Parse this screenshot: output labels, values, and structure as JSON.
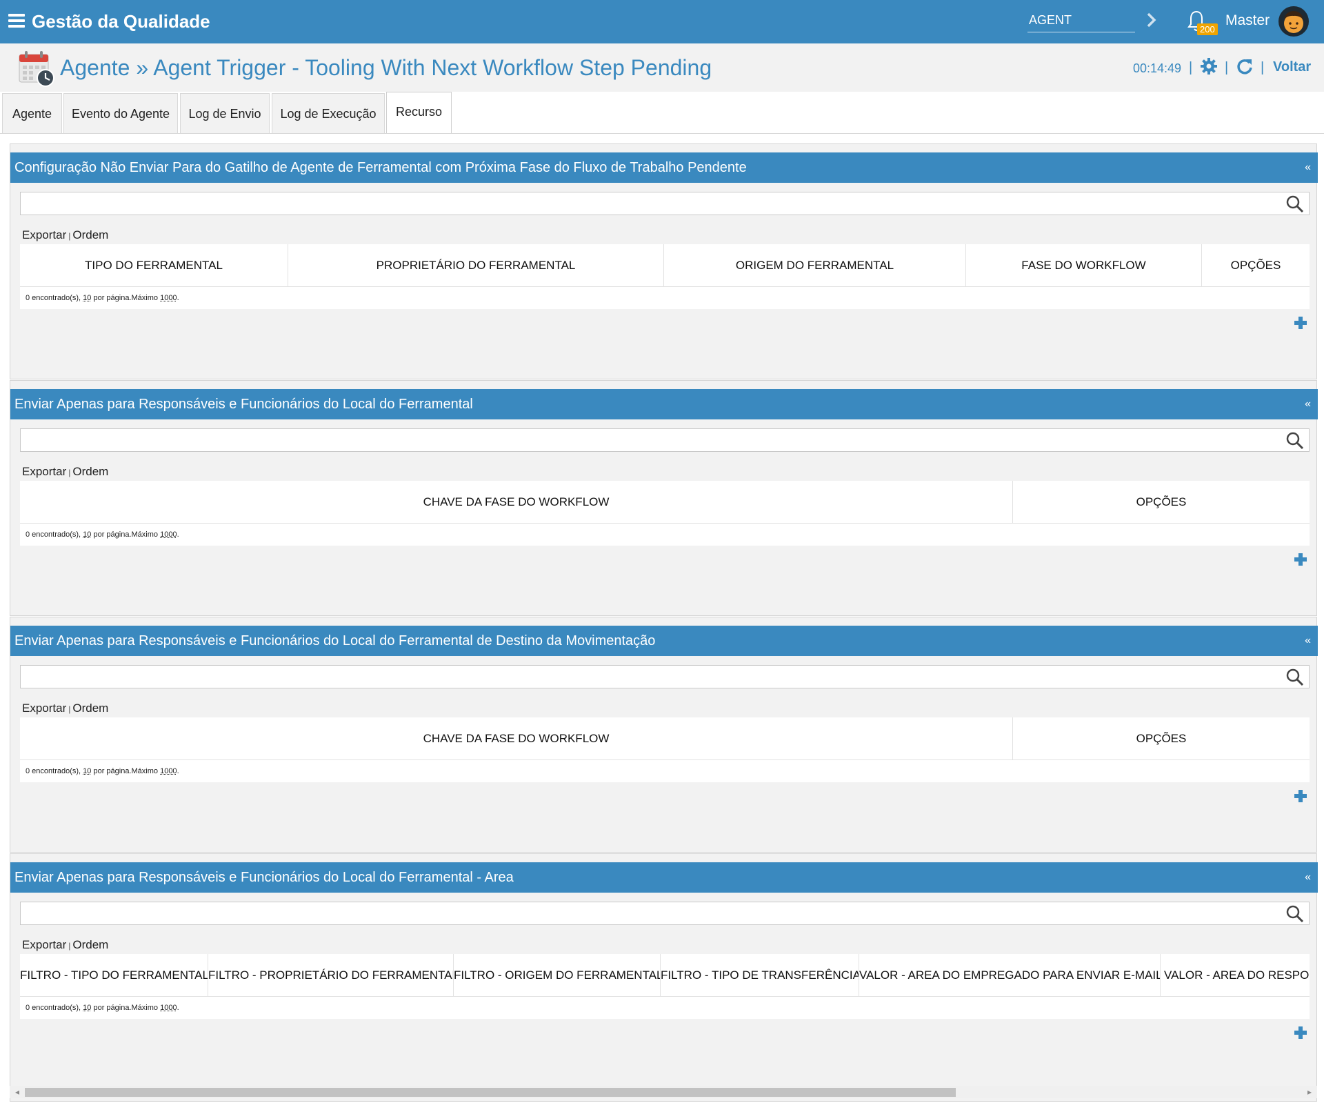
{
  "app": {
    "title": "Gestão da Qualidade"
  },
  "topbar": {
    "agent_value": "AGENT",
    "notifications_count": "200",
    "user_name": "Master"
  },
  "header": {
    "title": "Agente » Agent Trigger - Tooling With Next Workflow Step Pending",
    "timer": "00:14:49",
    "separator": "|",
    "back_label": "Voltar"
  },
  "tabs": [
    {
      "label": "Agente"
    },
    {
      "label": "Evento do Agente"
    },
    {
      "label": "Log de Envio"
    },
    {
      "label": "Log de Execução"
    },
    {
      "label": "Recurso"
    }
  ],
  "common": {
    "export_label": "Exportar",
    "pipe": "|",
    "order_label": "Ordem",
    "collapse": "«",
    "found_text": "0 encontrado(s), ",
    "per_page_value": "10",
    "per_page_text": " por página.Máximo ",
    "max_value": "1000",
    "period": "."
  },
  "sections": [
    {
      "title": "Configuração Não Enviar Para do Gatilho de Agente de Ferramental com Próxima Fase do Fluxo de Trabalho Pendente",
      "columns": [
        "TIPO DO FERRAMENTAL",
        "PROPRIETÁRIO DO FERRAMENTAL",
        "ORIGEM DO FERRAMENTAL",
        "FASE DO WORKFLOW",
        "OPÇÕES"
      ]
    },
    {
      "title": "Enviar Apenas para Responsáveis e Funcionários do Local do Ferramental",
      "columns": [
        "CHAVE DA FASE DO WORKFLOW",
        "OPÇÕES"
      ]
    },
    {
      "title": "Enviar Apenas para Responsáveis e Funcionários do Local do Ferramental de Destino da Movimentação",
      "columns": [
        "CHAVE DA FASE DO WORKFLOW",
        "OPÇÕES"
      ]
    },
    {
      "title": "Enviar Apenas para Responsáveis e Funcionários do Local do Ferramental - Area",
      "columns": [
        "FILTRO - TIPO DO FERRAMENTAL",
        "FILTRO - PROPRIETÁRIO DO FERRAMENTAL",
        "FILTRO - ORIGEM DO FERRAMENTAL",
        "FILTRO - TIPO DE TRANSFERÊNCIA",
        "VALOR - AREA DO EMPREGADO PARA ENVIAR E-MAIL",
        "VALOR - AREA DO RESPONS"
      ]
    }
  ],
  "colors": {
    "brand": "#3a89bf",
    "badge": "#f0a400"
  },
  "icons": [
    "menu-icon",
    "chevron-right-icon",
    "bell-icon",
    "avatar",
    "calendar-clock-icon",
    "gear-icon",
    "refresh-icon",
    "search-icon",
    "collapse-icon",
    "add-icon"
  ]
}
